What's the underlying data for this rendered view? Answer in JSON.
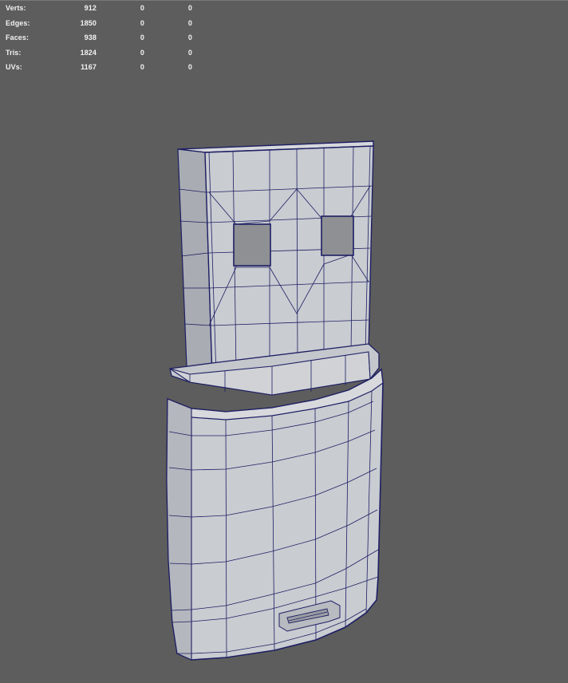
{
  "hud": {
    "rows": [
      {
        "label": "Verts:",
        "total": "912",
        "selected": "0",
        "tri_selected": "0"
      },
      {
        "label": "Edges:",
        "total": "1850",
        "selected": "0",
        "tri_selected": "0"
      },
      {
        "label": "Faces:",
        "total": "938",
        "selected": "0",
        "tri_selected": "0"
      },
      {
        "label": "Tris:",
        "total": "1824",
        "selected": "0",
        "tri_selected": "0"
      },
      {
        "label": "UVs:",
        "total": "1167",
        "selected": "0",
        "tri_selected": "0"
      }
    ]
  },
  "colors": {
    "viewport_bg": "#5d5d5d",
    "hud_text": "#f2f2f2",
    "mesh_face": "#c9ccd1",
    "mesh_face_shade": "#b2b5bb",
    "mesh_face_dark": "#a4a7ad",
    "wire": "#1e1f63",
    "slot": "#8f9094"
  }
}
